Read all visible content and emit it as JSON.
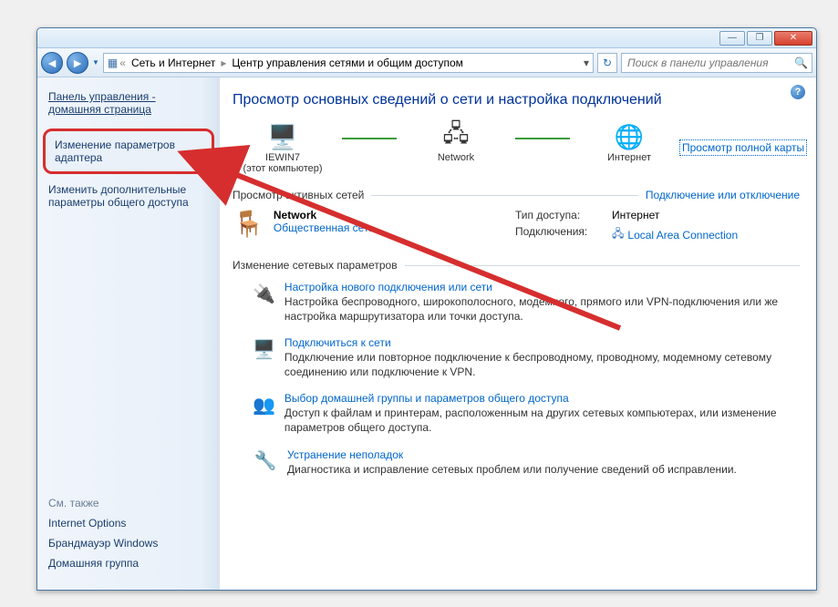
{
  "titlebar": {
    "minimize": "—",
    "maximize": "❐",
    "close": "✕"
  },
  "addressbar": {
    "prefix": "«",
    "seg1": "Сеть и Интернет",
    "seg2": "Центр управления сетями и общим доступом",
    "search_placeholder": "Поиск в панели управления"
  },
  "sidebar": {
    "home": "Панель управления - домашняя страница",
    "task1": "Изменение параметров адаптера",
    "task2": "Изменить дополнительные параметры общего доступа",
    "seealso_hdr": "См. также",
    "see1": "Internet Options",
    "see2": "Брандмауэр Windows",
    "see3": "Домашняя группа"
  },
  "content": {
    "heading": "Просмотр основных сведений о сети и настройка подключений",
    "map": {
      "node1_name": "IEWIN7",
      "node1_sub": "(этот компьютер)",
      "node2_name": "Network",
      "node3_name": "Интернет",
      "fullmap_link": "Просмотр полной карты"
    },
    "active_nets_hdr": "Просмотр активных сетей",
    "active_nets_link": "Подключение или отключение",
    "network": {
      "name": "Network",
      "type": "Общественная сеть",
      "access_lbl": "Тип доступа:",
      "access_val": "Интернет",
      "conn_lbl": "Подключения:",
      "conn_val": "Local Area Connection"
    },
    "settings_hdr": "Изменение сетевых параметров",
    "items": [
      {
        "icon": "🔌",
        "title": "Настройка нового подключения или сети",
        "desc": "Настройка беспроводного, широкополосного, модемного, прямого или VPN-подключения или же настройка маршрутизатора или точки доступа."
      },
      {
        "icon": "🖥️",
        "title": "Подключиться к сети",
        "desc": "Подключение или повторное подключение к беспроводному, проводному, модемному сетевому соединению или подключение к VPN."
      },
      {
        "icon": "👥",
        "title": "Выбор домашней группы и параметров общего доступа",
        "desc": "Доступ к файлам и принтерам, расположенным на других сетевых компьютерах, или изменение параметров общего доступа."
      },
      {
        "icon": "🔧",
        "title": "Устранение неполадок",
        "desc": "Диагностика и исправление сетевых проблем или получение сведений об исправлении."
      }
    ]
  }
}
